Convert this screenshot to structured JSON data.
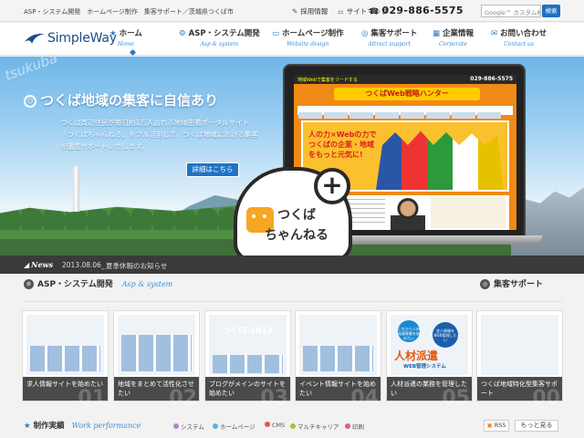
{
  "topbar": {
    "tagline": "ASP・システム開発　ホームページ制作　集客サポート／茨城県つくば市",
    "links": [
      {
        "icon": "pencil-icon",
        "label": "採用情報"
      },
      {
        "icon": "sitemap-icon",
        "label": "サイトマップ"
      }
    ],
    "phone": "029-886-5575",
    "search_placeholder": "Google™ カスタム検索",
    "search_button": "検索"
  },
  "header": {
    "logo_text": "SimpleWay",
    "nav": [
      {
        "icon": "star-icon",
        "label": "ホーム",
        "sub": "Home"
      },
      {
        "icon": "gear-icon",
        "label": "ASP・システム開発",
        "sub": "Asp & system"
      },
      {
        "icon": "monitor-icon",
        "label": "ホームページ制作",
        "sub": "Website design"
      },
      {
        "icon": "target-icon",
        "label": "集客サポート",
        "sub": "Attract support"
      },
      {
        "icon": "building-icon",
        "label": "企業情報",
        "sub": "Corporate"
      },
      {
        "icon": "mail-icon",
        "label": "お問い合わせ",
        "sub": "Contact us"
      }
    ]
  },
  "hero": {
    "watermark": "tsukuba",
    "headline": "つくば地域の集客に自信あり",
    "description": "つくば周辺住民が毎日約1万人訪れる地域密着ポータルサイト「つくばちゃんねる」をフル活用して、つくば地域における集客を徹底サポートいたします。",
    "button": "詳細はこちら",
    "screen_phone": "029-886-5575",
    "screen_bar": "地域Webで集客をリードする",
    "screen_title": "つくばWeb戦略ハンター",
    "screen_banner": "人の力×Webの力でつくばの企業・地域をもっと元気に!",
    "badge_line1": "つくば",
    "badge_line2": "ちゃんねる",
    "plus": "+"
  },
  "news": {
    "label": "News",
    "date": "2013.08.06_",
    "text": "夏季休暇のお知らせ"
  },
  "services": {
    "left_title": "ASP・システム開発",
    "left_sub": "Asp & system",
    "right_title": "集客サポート",
    "cards": [
      {
        "caption": "求人情報サイトを始めたい",
        "num": "01"
      },
      {
        "caption": "地域をまとめて活性化させたい",
        "num": "02"
      },
      {
        "caption": "ブログがメインのサイトを始めたい",
        "num": "03"
      },
      {
        "caption": "イベント情報サイトを始めたい",
        "num": "04"
      },
      {
        "caption": "人材派遣の業務を管理したい",
        "num": "05"
      },
      {
        "caption": "つくば地域特化型集客サポート",
        "num": "00"
      }
    ],
    "card5_bubble1": "これから人材派遣事業を始めたい",
    "card5_bubble2": "求人情報をWEB管理したい",
    "card5_big": "人材派遣",
    "card5_sub": "WEB管理システム",
    "card3_title": "つくロ-2013"
  },
  "performance": {
    "title": "制作実績",
    "sub": "Work performance",
    "legend": [
      {
        "label": "システム",
        "color": "#b77fd3"
      },
      {
        "label": "ホームページ",
        "color": "#5fb0e0"
      },
      {
        "label": "CMS",
        "color": "#e9573f"
      },
      {
        "label": "マルチキャリア",
        "color": "#9bc93c"
      },
      {
        "label": "印刷",
        "color": "#e05a96"
      }
    ],
    "rss": "RSS",
    "more": "もっと見る"
  }
}
